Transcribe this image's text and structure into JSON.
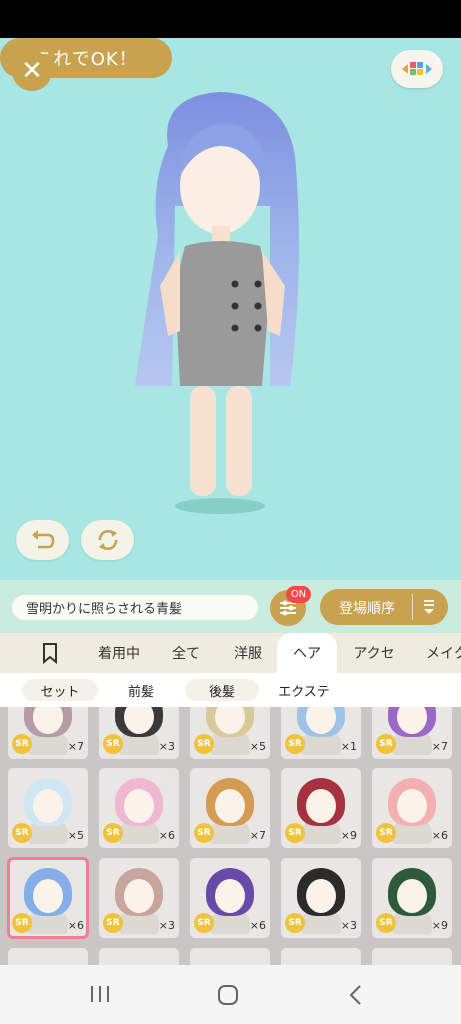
{
  "stage": {
    "close_icon": "close-icon",
    "palette_icon": "palette-icon",
    "ok_label": "これでOK！"
  },
  "search": {
    "value": "雪明かりに照らされる青髪"
  },
  "filter": {
    "badge": "ON"
  },
  "sort": {
    "label": "登場順序"
  },
  "tabs": [
    {
      "label": "着用中"
    },
    {
      "label": "全て"
    },
    {
      "label": "洋服"
    },
    {
      "label": "ヘア"
    },
    {
      "label": "アクセ"
    },
    {
      "label": "メイク"
    }
  ],
  "subtabs": [
    {
      "label": "セット"
    },
    {
      "label": "前髪"
    },
    {
      "label": "後髪"
    },
    {
      "label": "エクステ"
    }
  ],
  "grid": {
    "rarity": "SR",
    "rows": [
      [
        {
          "qty": "×7"
        },
        {
          "qty": "×3"
        },
        {
          "qty": "×5"
        },
        {
          "qty": "×1"
        },
        {
          "qty": "×7"
        }
      ],
      [
        {
          "qty": "×5"
        },
        {
          "qty": "×6"
        },
        {
          "qty": "×7"
        },
        {
          "qty": "×9"
        },
        {
          "qty": "×6"
        }
      ],
      [
        {
          "qty": "×6"
        },
        {
          "qty": "×3"
        },
        {
          "qty": "×6"
        },
        {
          "qty": "×3"
        },
        {
          "qty": "×9"
        }
      ]
    ]
  },
  "colors": {
    "stage_bg": "#a7e6e2",
    "gold": "#c8a24f",
    "selected_outline": "#ee7f94",
    "badge_red": "#f2494b"
  }
}
